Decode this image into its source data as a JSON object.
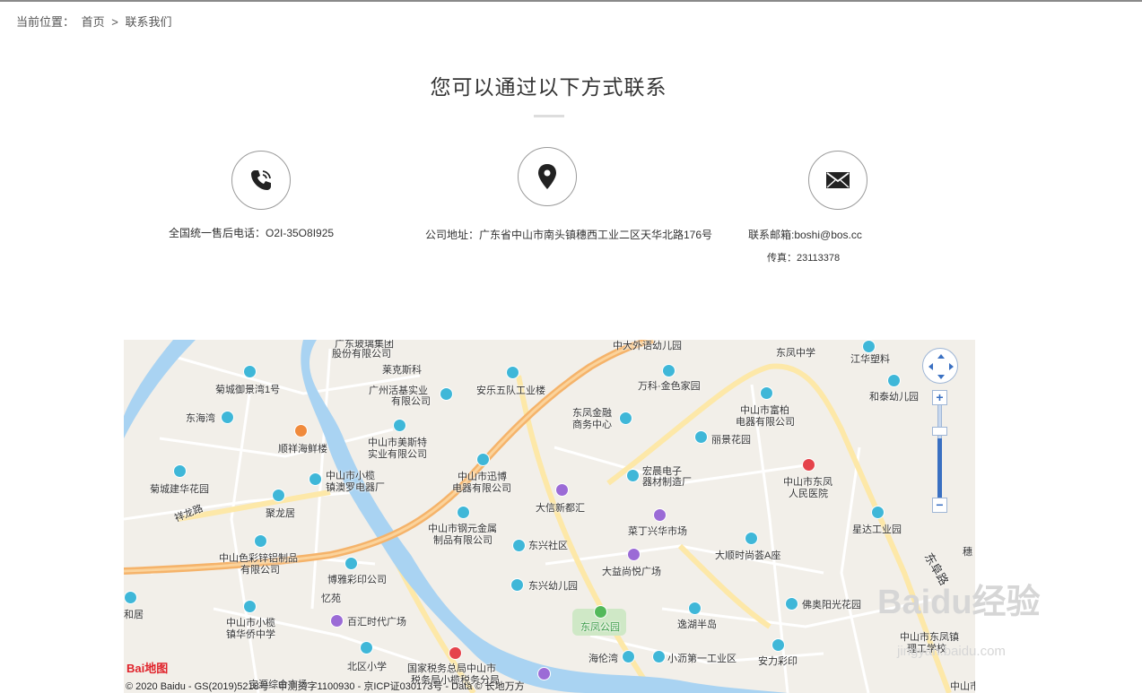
{
  "breadcrumb": {
    "prefix": "当前位置：",
    "home": "首页",
    "separator": ">",
    "current": "联系我们"
  },
  "title": "您可以通过以下方式联系",
  "contacts": {
    "phone": {
      "icon": "phone-icon",
      "text": "全国统一售后电话：O2I-35O8I925"
    },
    "address": {
      "icon": "location-pin-icon",
      "text": "公司地址：广东省中山市南头镇穗西工业二区天华北路176号"
    },
    "email": {
      "icon": "envelope-icon",
      "text": "联系邮箱:boshi@bos.cc",
      "fax": "传真：23113378"
    }
  },
  "map": {
    "labels": [
      "中大外语幼儿园",
      "东凤中学",
      "江华塑料",
      "莱克斯科",
      "菊城御景湾1号",
      "广州活基实业",
      "有限公司",
      "安乐五队工业楼",
      "万科·金色家园",
      "和泰幼儿园",
      "东海湾",
      "中山市富柏",
      "电器有限公司",
      "东凤金融",
      "商务中心",
      "顺祥海鲜楼",
      "中山市美斯特",
      "实业有限公司",
      "丽景花园",
      "中山市迅博",
      "电器有限公司",
      "宏晨电子",
      "器材制造厂",
      "中山市东凤",
      "人民医院",
      "中山市小榄",
      "镇澳罗电器厂",
      "菊城建华花园",
      "聚龙居",
      "大信新都汇",
      "祥龙路",
      "中山市钢元金属",
      "制品有限公司",
      "菜丁兴华市场",
      "星达工业园",
      "东兴社区",
      "中山色彩锌铝制品",
      "有限公司",
      "大顺时尚荟A座",
      "博雅彩印公司",
      "大益尚悦广场",
      "东阜路",
      "东兴幼儿园",
      "佛奥阳光花园",
      "和居",
      "百汇时代广场",
      "东凤公园",
      "逸湖半岛",
      "中山市小榄",
      "镇华侨中学",
      "中山市东凤镇",
      "理工学校",
      "北区小学",
      "国家税务总局中山市",
      "税务局小榄税务分局",
      "海伦湾",
      "小沥第一工业区",
      "安力彩印",
      "宝源综合市场",
      "中山市",
      "忆苑",
      "广东玻璃集团",
      "股份有限公司",
      "穗"
    ],
    "logo": "Bai地图",
    "copyright": "© 2020 Baidu - GS(2019)5218号 - 甲测资字1100930 - 京ICP证030173号 - Data © 长地万方",
    "zoom_in": "+",
    "zoom_out": "−",
    "watermark": "Baidu经验",
    "watermark_url": "jingyan.baidu.com"
  },
  "colors": {
    "river": "#a9d3f2",
    "highway": "#f5b36a",
    "road": "#fde8a8",
    "land": "#f2efe9"
  }
}
